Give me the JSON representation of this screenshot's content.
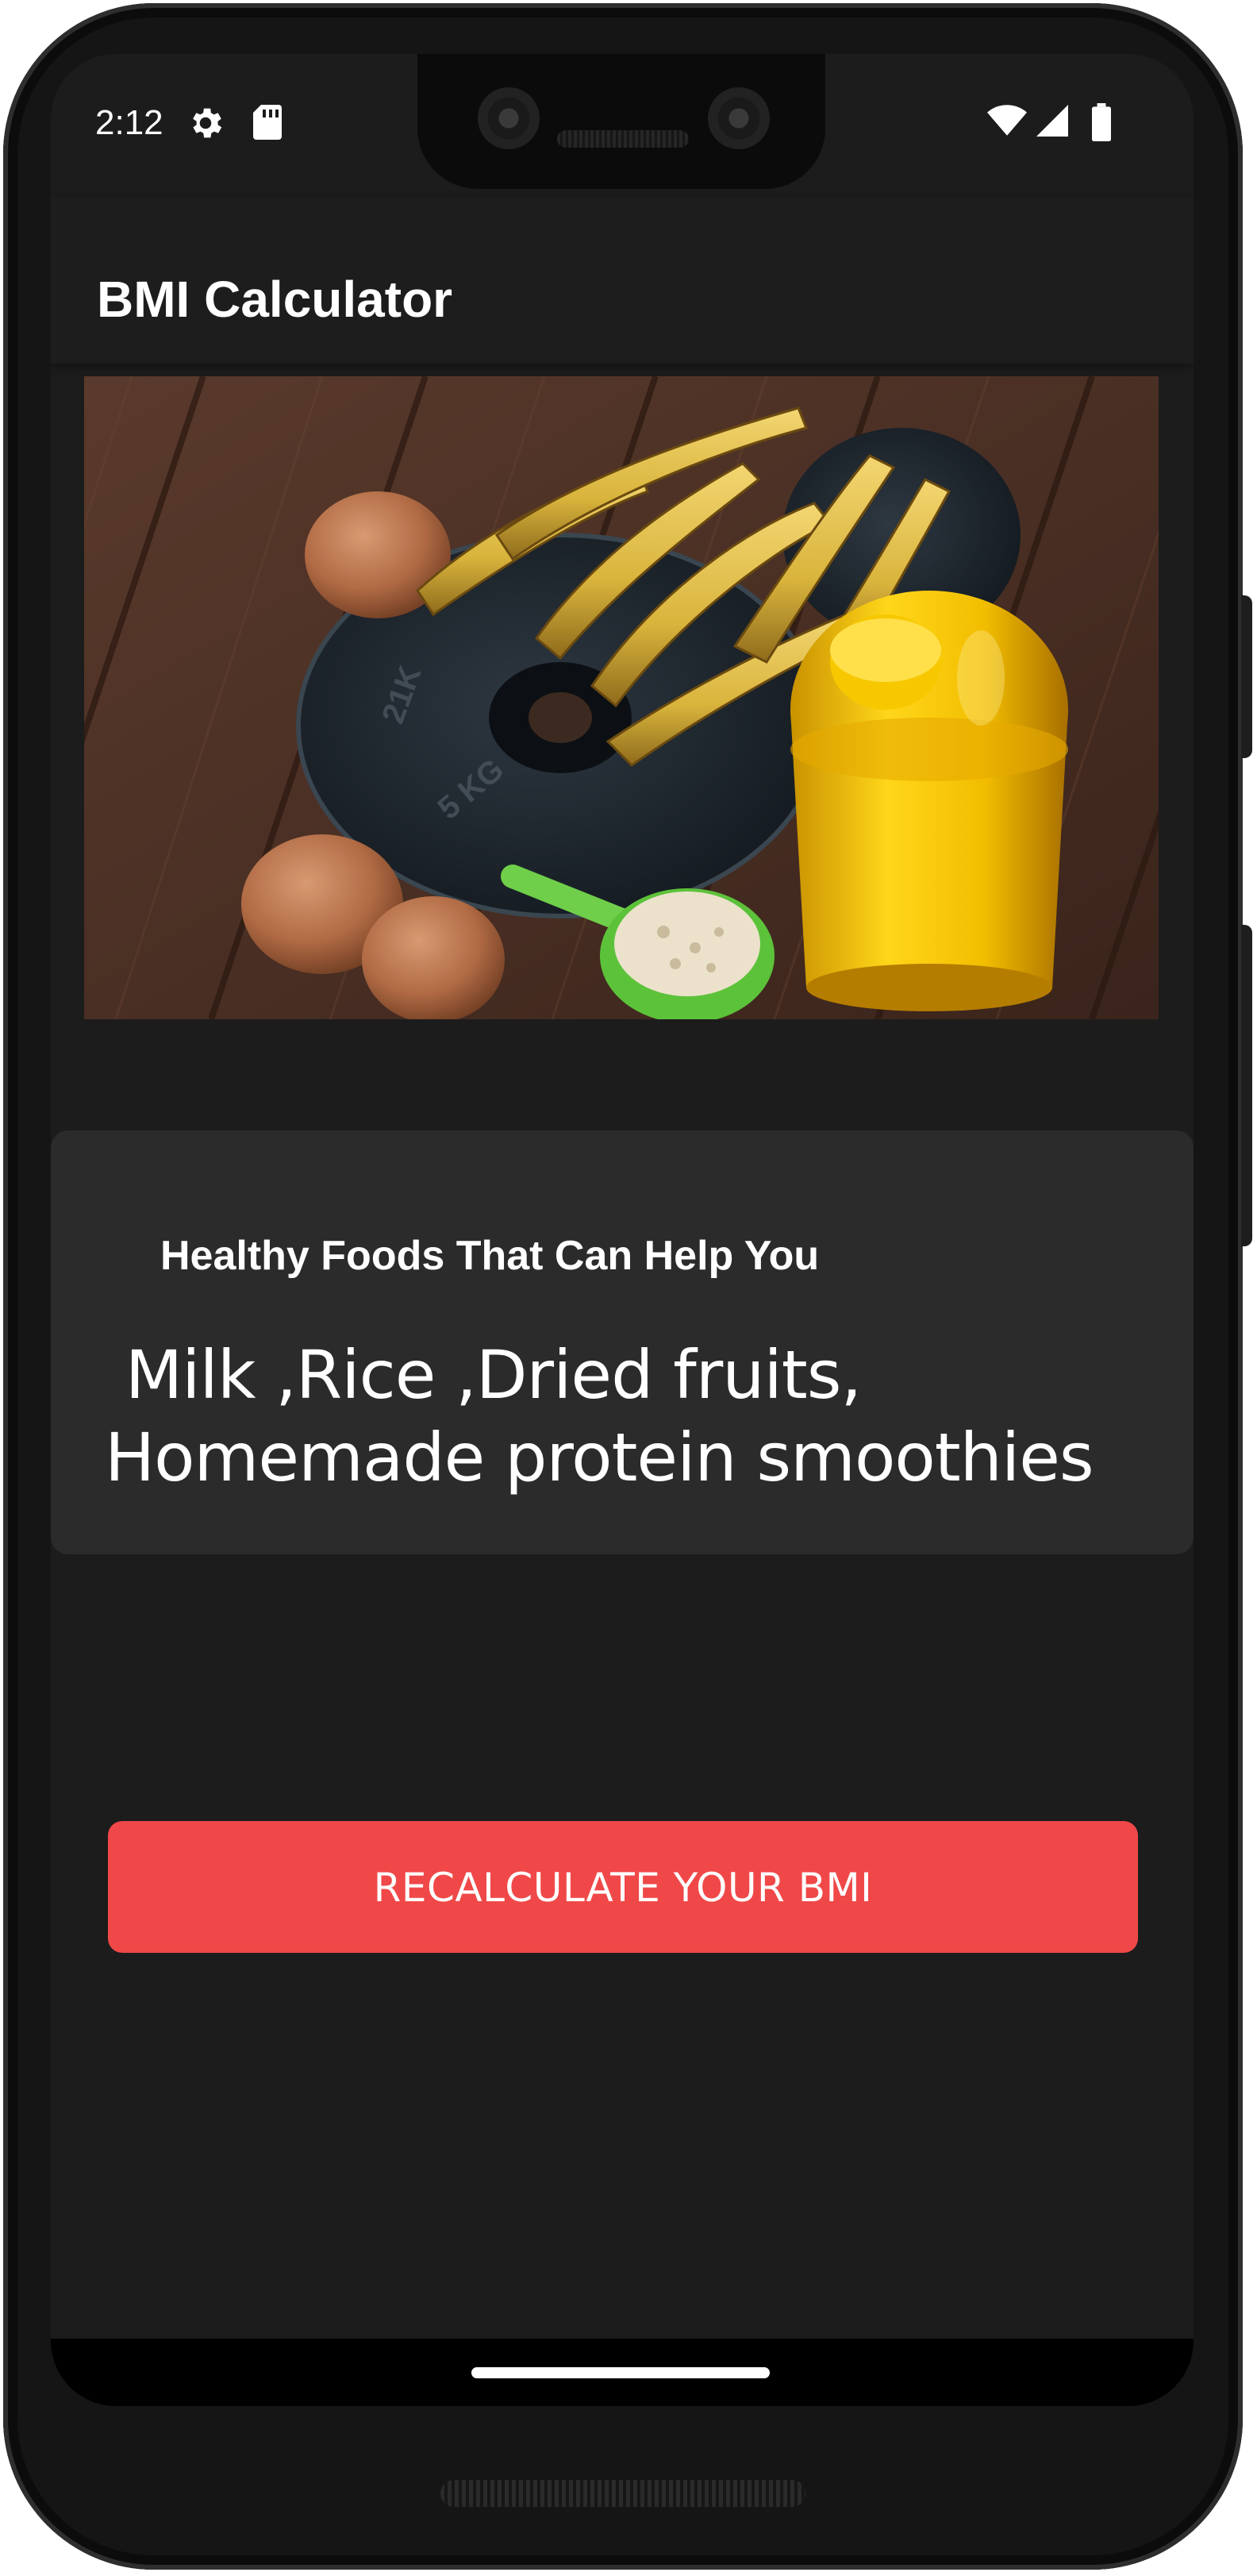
{
  "status_bar": {
    "time": "2:12",
    "icons": [
      "settings-icon",
      "sd-card-icon",
      "wifi-icon",
      "cell-signal-icon",
      "battery-icon"
    ]
  },
  "app_bar": {
    "title": "BMI Calculator"
  },
  "hero_image": {
    "subject": "bananas, eggs, weight plate, protein shaker and scoop on wooden table"
  },
  "result_card": {
    "heading": "Healthy Foods That Can Help You",
    "line1": " Milk ,Rice ,Dried fruits,",
    "line2": "Homemade protein smoothies"
  },
  "actions": {
    "recalculate_label": "RECALCULATE YOUR BMI"
  },
  "colors": {
    "background": "#1c1c1c",
    "card": "#2b2b2b",
    "accent_button": "#f04848",
    "text": "#ffffff"
  }
}
